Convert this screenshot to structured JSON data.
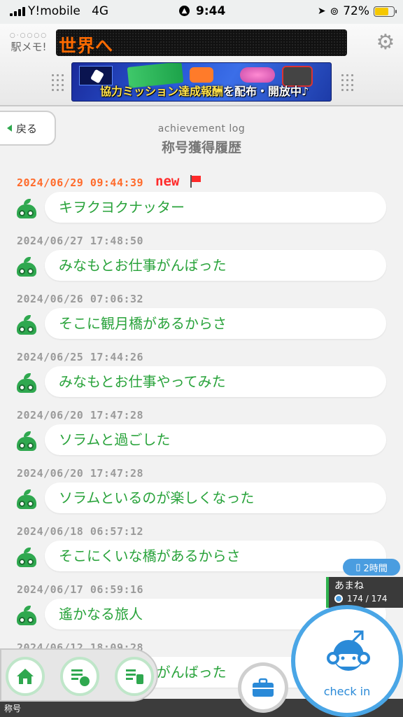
{
  "status_bar": {
    "carrier": "Y!mobile",
    "network": "4G",
    "time": "9:44",
    "battery": "72%",
    "battery_level": 0.72
  },
  "header": {
    "logo_text": "駅メモ!",
    "marquee_text": "世界へ",
    "banner_text_highlight": "協力ミッション達成報酬",
    "banner_text_rest": "を配布・開放中♪"
  },
  "nav": {
    "back_label": "戻る"
  },
  "page": {
    "subtitle": "achievement log",
    "title": "称号獲得履歴"
  },
  "log": {
    "new_label": "new",
    "entries": [
      {
        "date": "2024/06/29 09:44:39",
        "title": "キヲクヨクナッター",
        "is_new": true
      },
      {
        "date": "2024/06/27 17:48:50",
        "title": "みなもとお仕事がんばった",
        "is_new": false
      },
      {
        "date": "2024/06/26 07:06:32",
        "title": "そこに観月橋があるからさ",
        "is_new": false
      },
      {
        "date": "2024/06/25 17:44:26",
        "title": "みなもとお仕事やってみた",
        "is_new": false
      },
      {
        "date": "2024/06/20 17:47:28",
        "title": "ソラムと過ごした",
        "is_new": false
      },
      {
        "date": "2024/06/20 17:47:28",
        "title": "ソラムといるのが楽しくなった",
        "is_new": false
      },
      {
        "date": "2024/06/18 06:57:12",
        "title": "そこにくいな橋があるからさ",
        "is_new": false
      },
      {
        "date": "2024/06/17 06:59:16",
        "title": "遙かなる旅人",
        "is_new": false
      },
      {
        "date": "2024/06/12 18:09:28",
        "title": "みなもとお仕事がんばった",
        "is_new": false
      }
    ]
  },
  "overlay": {
    "eta_label": "2時間",
    "character_name": "あまね",
    "character_hp": "174 / 174",
    "checkin_label": "check in",
    "bottom_label": "称号"
  },
  "colors": {
    "accent_green": "#29a33b",
    "new_date": "#ff6a2a",
    "checkin_blue": "#4aa6e6"
  }
}
